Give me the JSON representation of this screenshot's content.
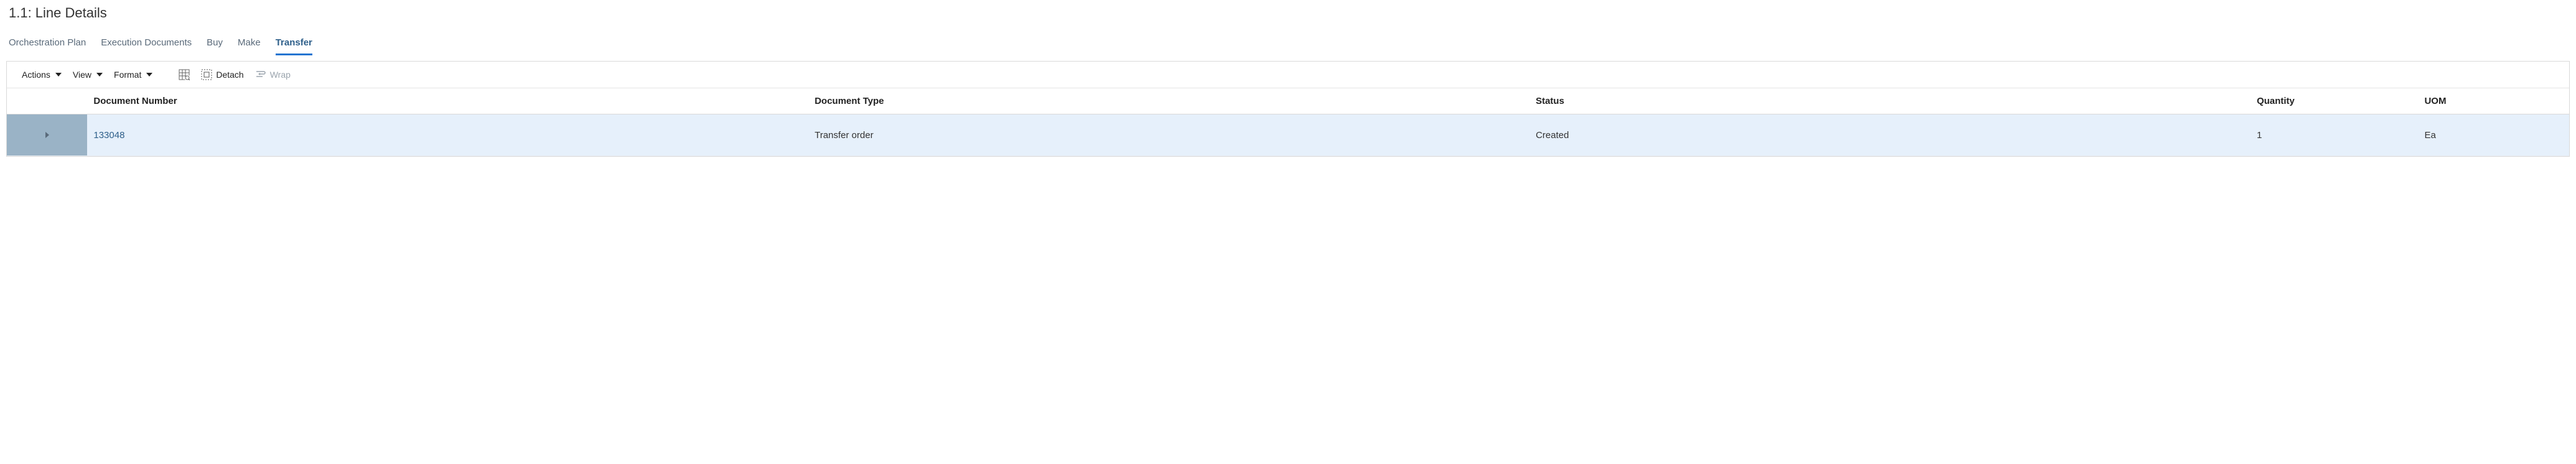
{
  "page_title": "1.1: Line Details",
  "tabs": [
    {
      "label": "Orchestration Plan",
      "active": false
    },
    {
      "label": "Execution Documents",
      "active": false
    },
    {
      "label": "Buy",
      "active": false
    },
    {
      "label": "Make",
      "active": false
    },
    {
      "label": "Transfer",
      "active": true
    }
  ],
  "toolbar": {
    "actions_label": "Actions",
    "view_label": "View",
    "format_label": "Format",
    "detach_label": "Detach",
    "wrap_label": "Wrap"
  },
  "table": {
    "columns": {
      "doc_number": "Document Number",
      "doc_type": "Document Type",
      "status": "Status",
      "quantity": "Quantity",
      "uom": "UOM"
    },
    "rows": [
      {
        "doc_number": "133048",
        "doc_type": "Transfer order",
        "status": "Created",
        "quantity": "1",
        "uom": "Ea"
      }
    ]
  }
}
